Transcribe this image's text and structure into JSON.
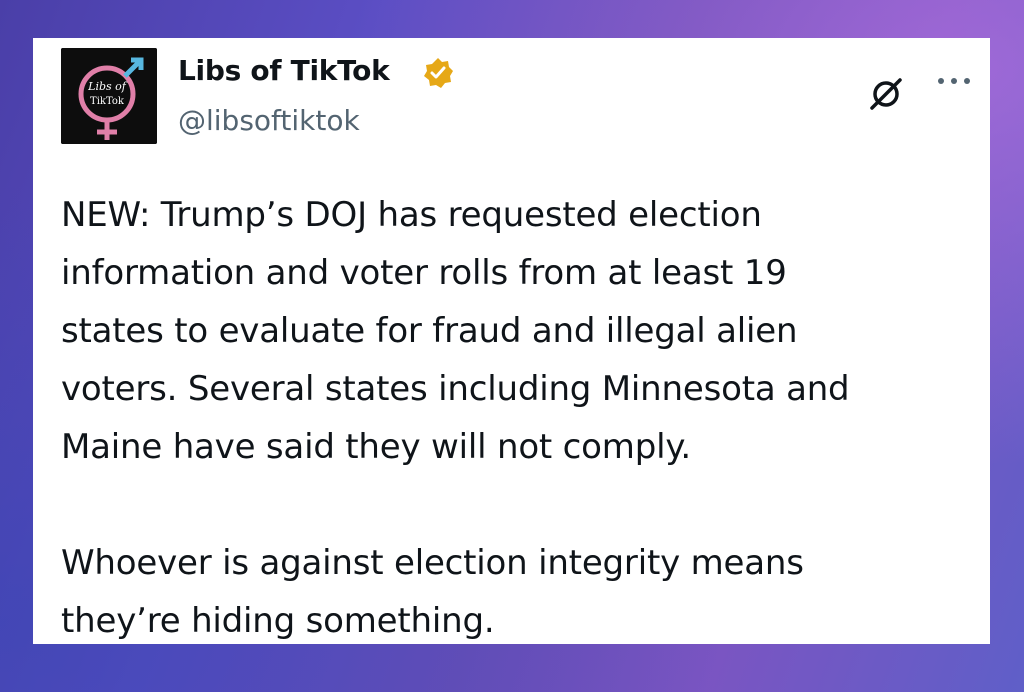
{
  "post": {
    "author": {
      "display_name": "Libs of TikTok",
      "handle": "@libsoftiktok",
      "verified": true,
      "verified_color": "#e6a817",
      "avatar_text_line1": "Libs of",
      "avatar_text_line2": "TikTok"
    },
    "text": "NEW: Trump’s DOJ has requested election\ninformation and voter rolls from at least 19\nstates to evaluate for fraud and illegal alien\nvoters. Several states including Minnesota and\nMaine have said they will not comply.\n\nWhoever is against election integrity means\nthey’re hiding something.",
    "actions": {
      "grok_icon": "grok-icon",
      "more_icon": "more-icon"
    }
  }
}
